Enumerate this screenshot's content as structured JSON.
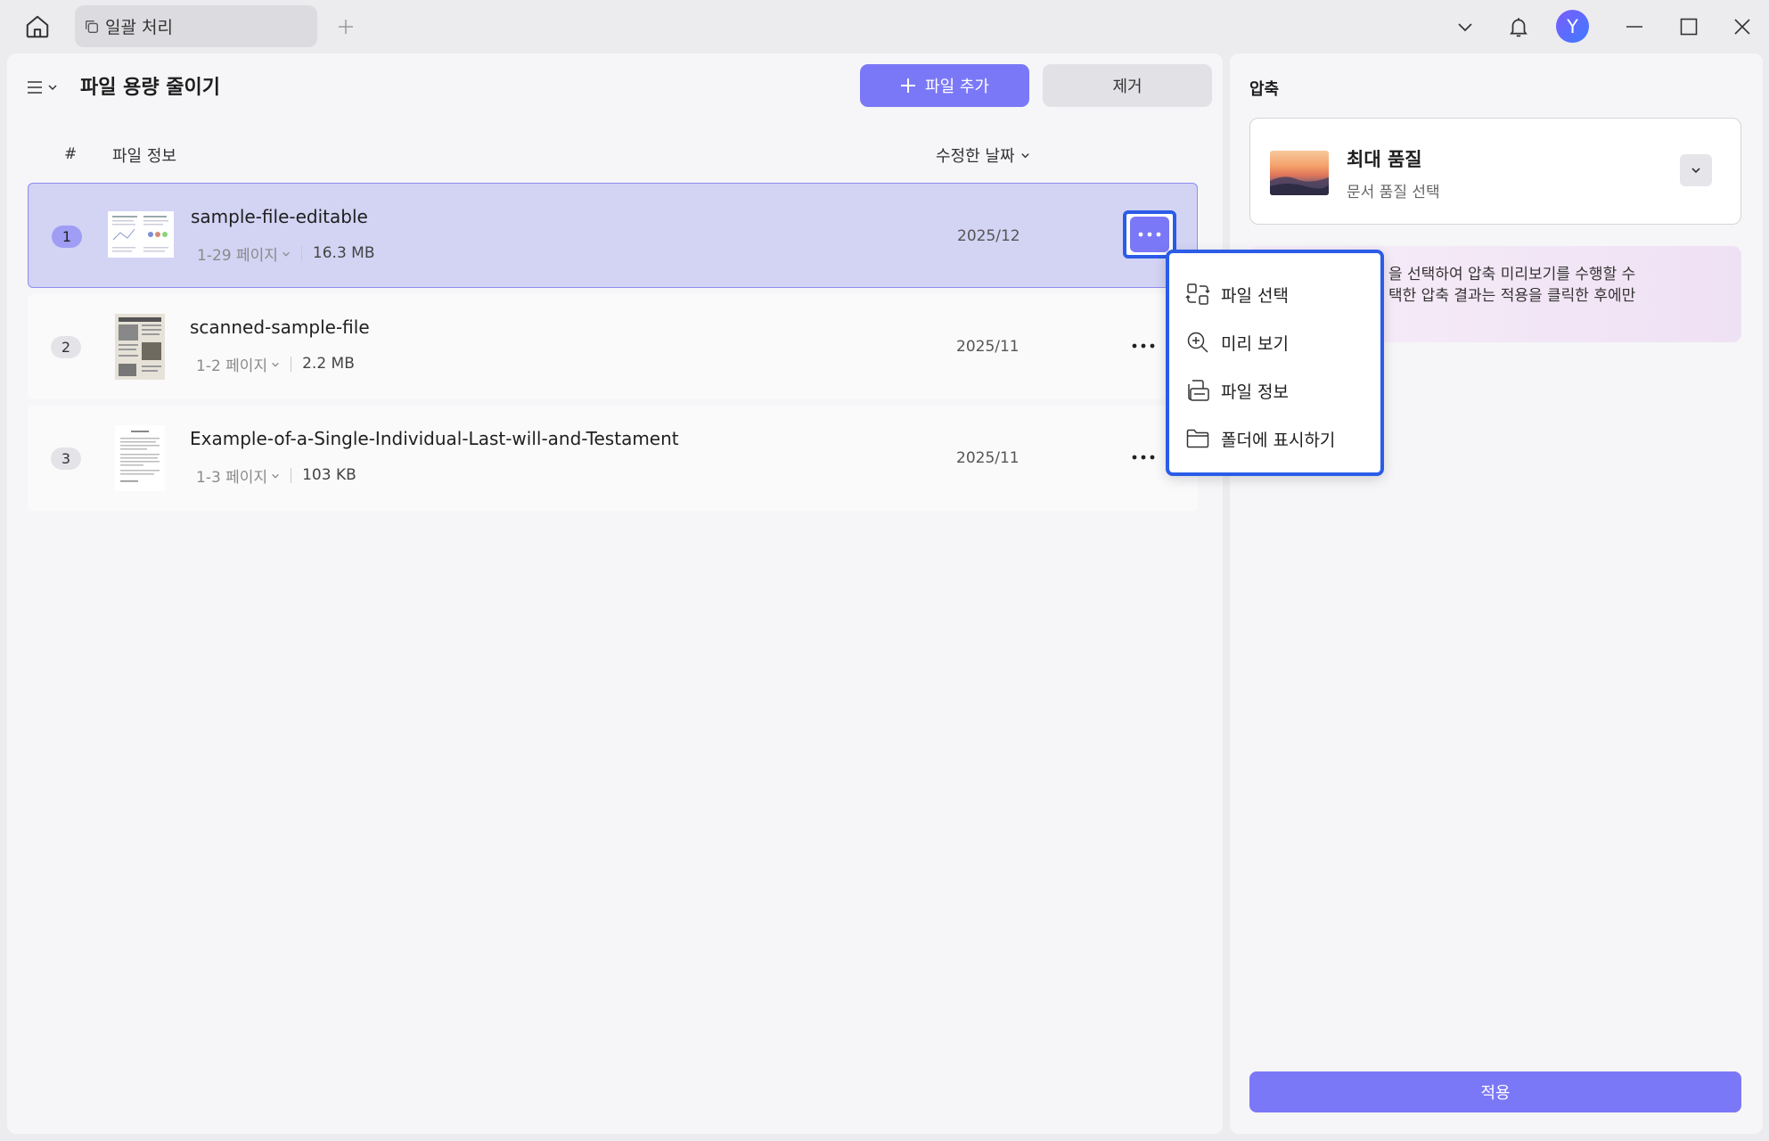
{
  "titlebar": {
    "tab_label": "일괄 처리",
    "avatar_letter": "Y"
  },
  "toolbar": {
    "title": "파일 용량 줄이기",
    "add_file_label": "파일 추가",
    "remove_label": "제거"
  },
  "table": {
    "headers": {
      "number": "#",
      "file_info": "파일 정보",
      "modified_date": "수정한 날짜"
    },
    "rows": [
      {
        "num": "1",
        "name": "sample-file-editable",
        "pages": "1-29 페이지",
        "size": "16.3 MB",
        "date": "2025/12",
        "selected": true
      },
      {
        "num": "2",
        "name": "scanned-sample-file",
        "pages": "1-2 페이지",
        "size": "2.2 MB",
        "date": "2025/11",
        "selected": false
      },
      {
        "num": "3",
        "name": "Example-of-a-Single-Individual-Last-will-and-Testament",
        "pages": "1-3 페이지",
        "size": "103 KB",
        "date": "2025/11",
        "selected": false
      }
    ]
  },
  "context_menu": {
    "items": [
      {
        "label": "파일 선택",
        "icon": "swap-file-icon"
      },
      {
        "label": "미리 보기",
        "icon": "zoom-in-icon"
      },
      {
        "label": "파일 정보",
        "icon": "file-info-icon"
      },
      {
        "label": "폴더에 표시하기",
        "icon": "folder-icon"
      }
    ]
  },
  "compress_panel": {
    "title": "압축",
    "quality_title": "최대 품질",
    "quality_subtitle": "문서 품질 선택",
    "info_line1": "을 선택하여 압축 미리보기를 수행할 수",
    "info_line2": "택한 압축 결과는 적용을 클릭한 후에만",
    "apply_label": "적용"
  },
  "colors": {
    "accent": "#7b78f7",
    "highlight_border": "#2b5ce8",
    "selected_row": "#d3d3f4"
  }
}
